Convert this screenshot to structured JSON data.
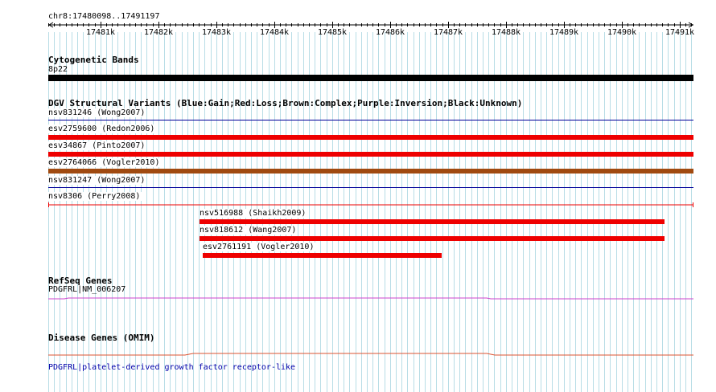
{
  "ruler": {
    "region": "chr8:17480098..17491197",
    "ticks": [
      "17481k",
      "17482k",
      "17483k",
      "17484k",
      "17485k",
      "17486k",
      "17487k",
      "17488k",
      "17489k",
      "17490k",
      "17491k"
    ]
  },
  "cytoband": {
    "title": "Cytogenetic Bands",
    "band": "8p22",
    "color": "#000000"
  },
  "dgv": {
    "title": "DGV Structural Variants (Blue:Gain;Red:Loss;Brown:Complex;Purple:Inversion;Black:Unknown)",
    "colors": {
      "loss": "#ee0000",
      "complex": "#a04a10",
      "gain": "#000099"
    },
    "variants": [
      {
        "label": "nsv831246 (Wong2007)",
        "type": "gain"
      },
      {
        "label": "esv2759600 (Redon2006)",
        "type": "loss"
      },
      {
        "label": "esv34867 (Pinto2007)",
        "type": "loss"
      },
      {
        "label": "esv2764066 (Vogler2010)",
        "type": "complex"
      },
      {
        "label": "nsv831247 (Wong2007)",
        "type": "gain"
      },
      {
        "label": "nsv8306 (Perry2008)",
        "type": "loss"
      },
      {
        "label": "nsv516988 (Shaikh2009)",
        "type": "loss"
      },
      {
        "label": "nsv818612 (Wang2007)",
        "type": "loss"
      },
      {
        "label": "esv2761191 (Vogler2010)",
        "type": "loss"
      }
    ]
  },
  "refseq": {
    "title": "RefSeq Genes",
    "gene": "PDGFRL|NM_006207",
    "color": "#cc44cc"
  },
  "omim": {
    "title": "Disease Genes (OMIM)",
    "gene": "PDGFRL|platelet-derived growth factor receptor-like",
    "color": "#dd5533"
  }
}
